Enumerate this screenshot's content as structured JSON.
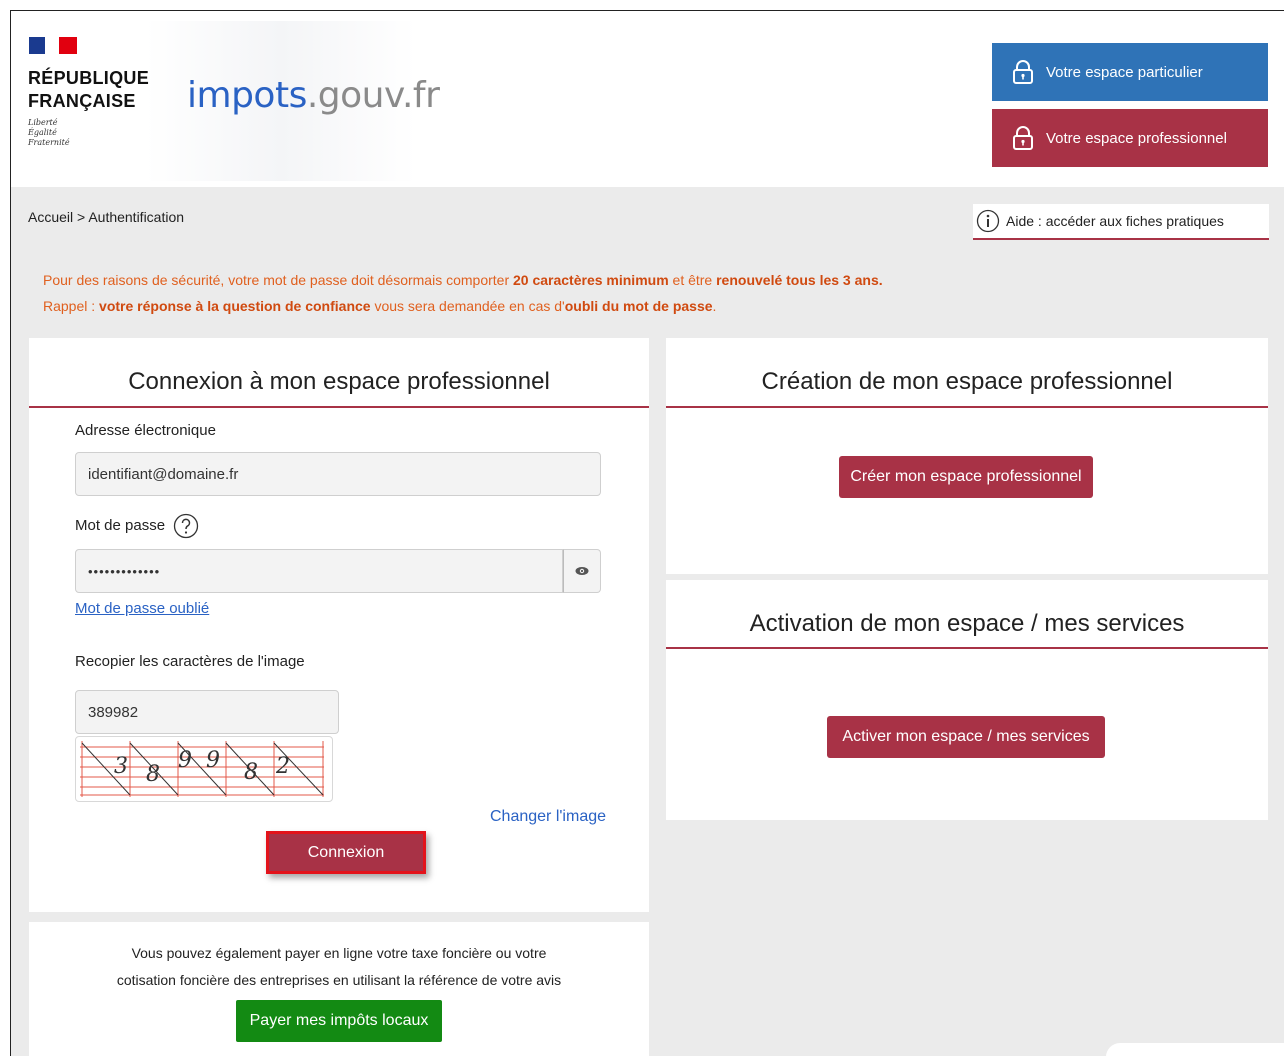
{
  "header": {
    "republic_line1": "RÉPUBLIQUE",
    "republic_line2": "FRANÇAISE",
    "devise": [
      "Liberté",
      "Égalité",
      "Fraternité"
    ],
    "site_name_part1": "impots",
    "site_name_part2": ".gouv.fr",
    "btn_particulier": "Votre espace particulier",
    "btn_professionnel": "Votre espace professionnel"
  },
  "breadcrumb": "Accueil > Authentification",
  "aide": "Aide : accéder aux fiches pratiques",
  "notice": {
    "line1_a": "Pour des raisons de sécurité, votre mot de passe doit désormais comporter ",
    "line1_b": "20 caractères minimum",
    "line1_c": " et être ",
    "line1_d": "renouvelé tous les 3 ans.",
    "line2_a": "Rappel : ",
    "line2_b": "votre réponse à la question de confiance",
    "line2_c": " vous sera demandée en cas d'",
    "line2_d": "oubli du mot de passe",
    "line2_e": "."
  },
  "login": {
    "title": "Connexion à mon espace professionnel",
    "email_label": "Adresse électronique",
    "email_value": "identifiant@domaine.fr",
    "password_label": "Mot de passe",
    "password_value": "•••••••••••••",
    "forgot_link": "Mot de passe oublié",
    "captcha_label": "Recopier les caractères de l'image",
    "captcha_value": "389982",
    "captcha_chars": [
      "3",
      "8",
      "9",
      "9",
      "8",
      "2"
    ],
    "change_image": "Changer l'image",
    "submit": "Connexion"
  },
  "pay": {
    "line1": "Vous pouvez également payer en ligne votre taxe foncière ou votre",
    "line2": "cotisation foncière des entreprises en utilisant la référence de votre avis",
    "button": "Payer mes impôts locaux"
  },
  "creation": {
    "title": "Création de mon espace professionnel",
    "button": "Créer mon espace professionnel"
  },
  "activation": {
    "title": "Activation de mon espace / mes services",
    "button": "Activer mon espace / mes services"
  },
  "colors": {
    "brand_red": "#a83246",
    "brand_blue": "#2f73b7",
    "notice_orange": "#e0601f",
    "pay_green": "#138a13"
  }
}
